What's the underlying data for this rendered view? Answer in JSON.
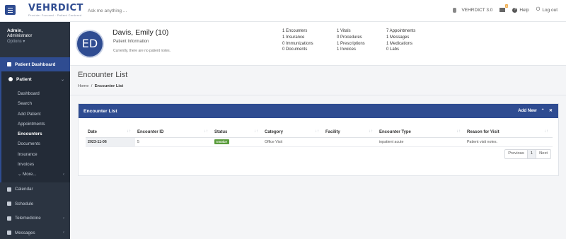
{
  "header": {
    "logo": "VEHRDICT",
    "tagline": "Provider Focused · Patient Centered",
    "search_placeholder": "Ask me anything ...",
    "version": "VEHRDICT 3.0",
    "message_badge": "0",
    "help": "Help",
    "logout": "Log out"
  },
  "sidebar": {
    "user_name": "Admin,",
    "user_role": "Administrator",
    "options": "Options ▾",
    "dashboard": "Patient Dashboard",
    "patient": "Patient",
    "patient_sub": [
      "Dashboard",
      "Search",
      "Add Patient",
      "Appointments",
      "Encounters",
      "Documents",
      "Insurance",
      "Invoices",
      "⌄ More..."
    ],
    "active_sub": "Encounters",
    "nav": [
      "Calendar",
      "Schedule",
      "Telemedicine",
      "Messages"
    ]
  },
  "patient": {
    "initials": "ED",
    "name": "Davis, Emily (10)",
    "info_label": "Patient Information",
    "note": "Currently, there are no patient notes.",
    "stats": [
      "1 Encounters",
      "1 Vitals",
      "7 Appointments",
      "1 Insurance",
      "0 Procedures",
      "1 Messages",
      "0 Immunizations",
      "1 Prescriptions",
      "1 Medications",
      "0 Documents",
      "1 Invoices",
      "0 Labs"
    ]
  },
  "page": {
    "title": "Encounter List",
    "breadcrumb_home": "Home",
    "breadcrumb_sep": "/",
    "breadcrumb_current": "Encounter List"
  },
  "card": {
    "title": "Encounter List",
    "add_new": "Add New",
    "columns": [
      "Date",
      "Encounter ID",
      "Status",
      "Category",
      "Facility",
      "Encounter Type",
      "Reason for Visit"
    ],
    "rows": [
      {
        "date": "2023-11-06",
        "id": "5",
        "status": "Invoice",
        "category": "Office Visit",
        "facility": "",
        "type": "inpatient acute",
        "reason": "Patient visit notes."
      }
    ],
    "pager": {
      "previous": "Previous",
      "page": "1",
      "next": "Next"
    }
  }
}
